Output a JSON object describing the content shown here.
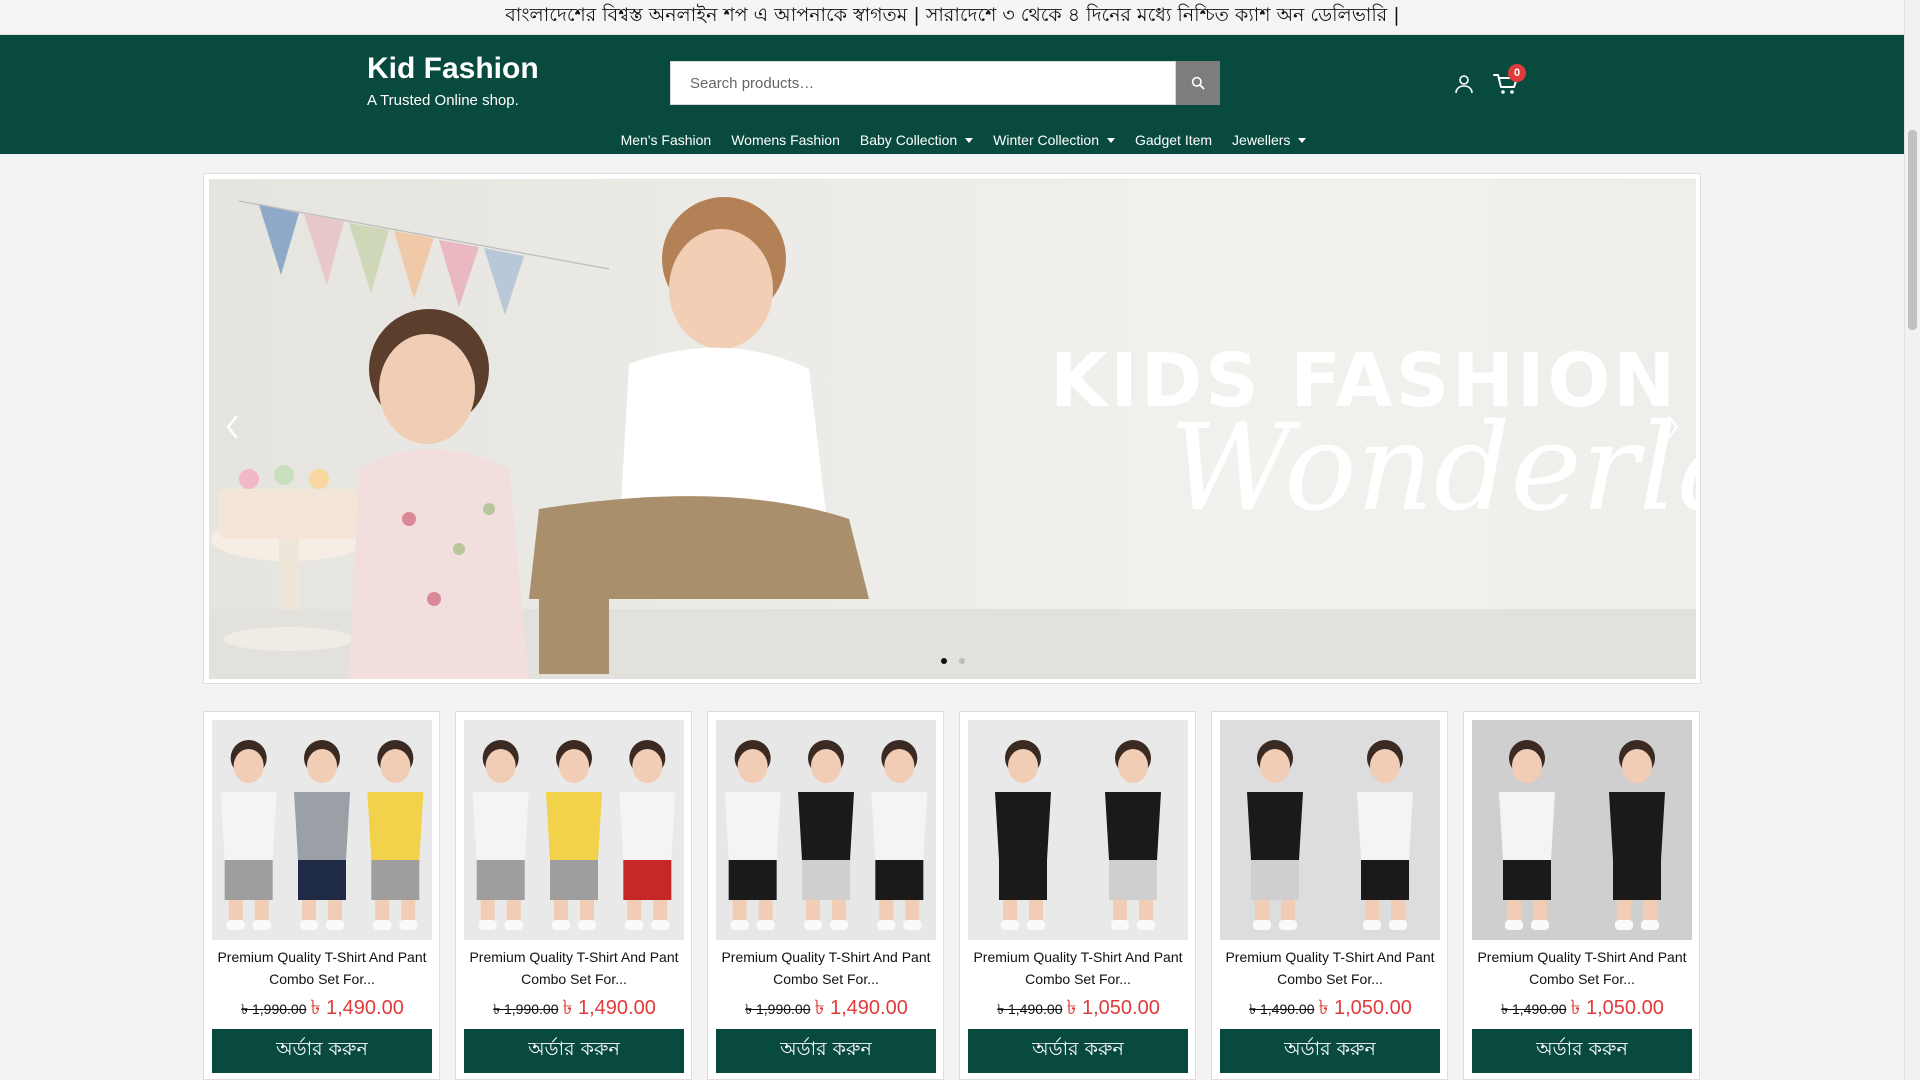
{
  "announcement": "বাংলাদেশের বিশ্বস্ত অনলাইন শপ এ আপনাকে স্বাগতম | সারাদেশে ৩ থেকে ৪ দিনের মধ্যে নিশ্চিত ক্যাশ অন ডেলিভারি |",
  "header": {
    "site_title": "Kid Fashion",
    "tagline": "A Trusted Online shop.",
    "search_placeholder": "Search products…",
    "cart_count": "0"
  },
  "nav": {
    "items": [
      {
        "label": "Men's Fashion",
        "dropdown": false
      },
      {
        "label": "Womens Fashion",
        "dropdown": false
      },
      {
        "label": "Baby Collection",
        "dropdown": true
      },
      {
        "label": "Winter Collection",
        "dropdown": true
      },
      {
        "label": "Gadget Item",
        "dropdown": false
      },
      {
        "label": "Jewellers",
        "dropdown": true
      }
    ]
  },
  "hero": {
    "heading": "KIDS FASHION",
    "script": "Wonderland",
    "slide_count": 2,
    "active_slide": 1
  },
  "products": [
    {
      "title": "Premium Quality T-Shirt And Pant Combo Set For...",
      "old_price": "৳ 1,990.00",
      "price": "৳ 1,490.00",
      "button": "অর্ডার করুন"
    },
    {
      "title": "Premium Quality T-Shirt And Pant Combo Set For...",
      "old_price": "৳ 1,990.00",
      "price": "৳ 1,490.00",
      "button": "অর্ডার করুন"
    },
    {
      "title": "Premium Quality T-Shirt And Pant Combo Set For...",
      "old_price": "৳ 1,990.00",
      "price": "৳ 1,490.00",
      "button": "অর্ডার করুন"
    },
    {
      "title": "Premium Quality T-Shirt And Pant Combo Set For...",
      "old_price": "৳ 1,490.00",
      "price": "৳ 1,050.00",
      "button": "অর্ডার করুন"
    },
    {
      "title": "Premium Quality T-Shirt And Pant Combo Set For...",
      "old_price": "৳ 1,490.00",
      "price": "৳ 1,050.00",
      "button": "অর্ডার করুন"
    },
    {
      "title": "Premium Quality T-Shirt And Pant Combo Set For...",
      "old_price": "৳ 1,490.00",
      "price": "৳ 1,050.00",
      "button": "অর্ডার করুন"
    }
  ],
  "colors": {
    "brand": "#094a3e",
    "sale_price": "#e03b3b",
    "search_button": "#7d7d7d",
    "cart_badge": "#e03b3b"
  },
  "icons": {
    "search": "search-icon",
    "account": "user-icon",
    "cart": "cart-icon",
    "slider_prev": "chevron-left-icon",
    "slider_next": "chevron-right-icon"
  }
}
